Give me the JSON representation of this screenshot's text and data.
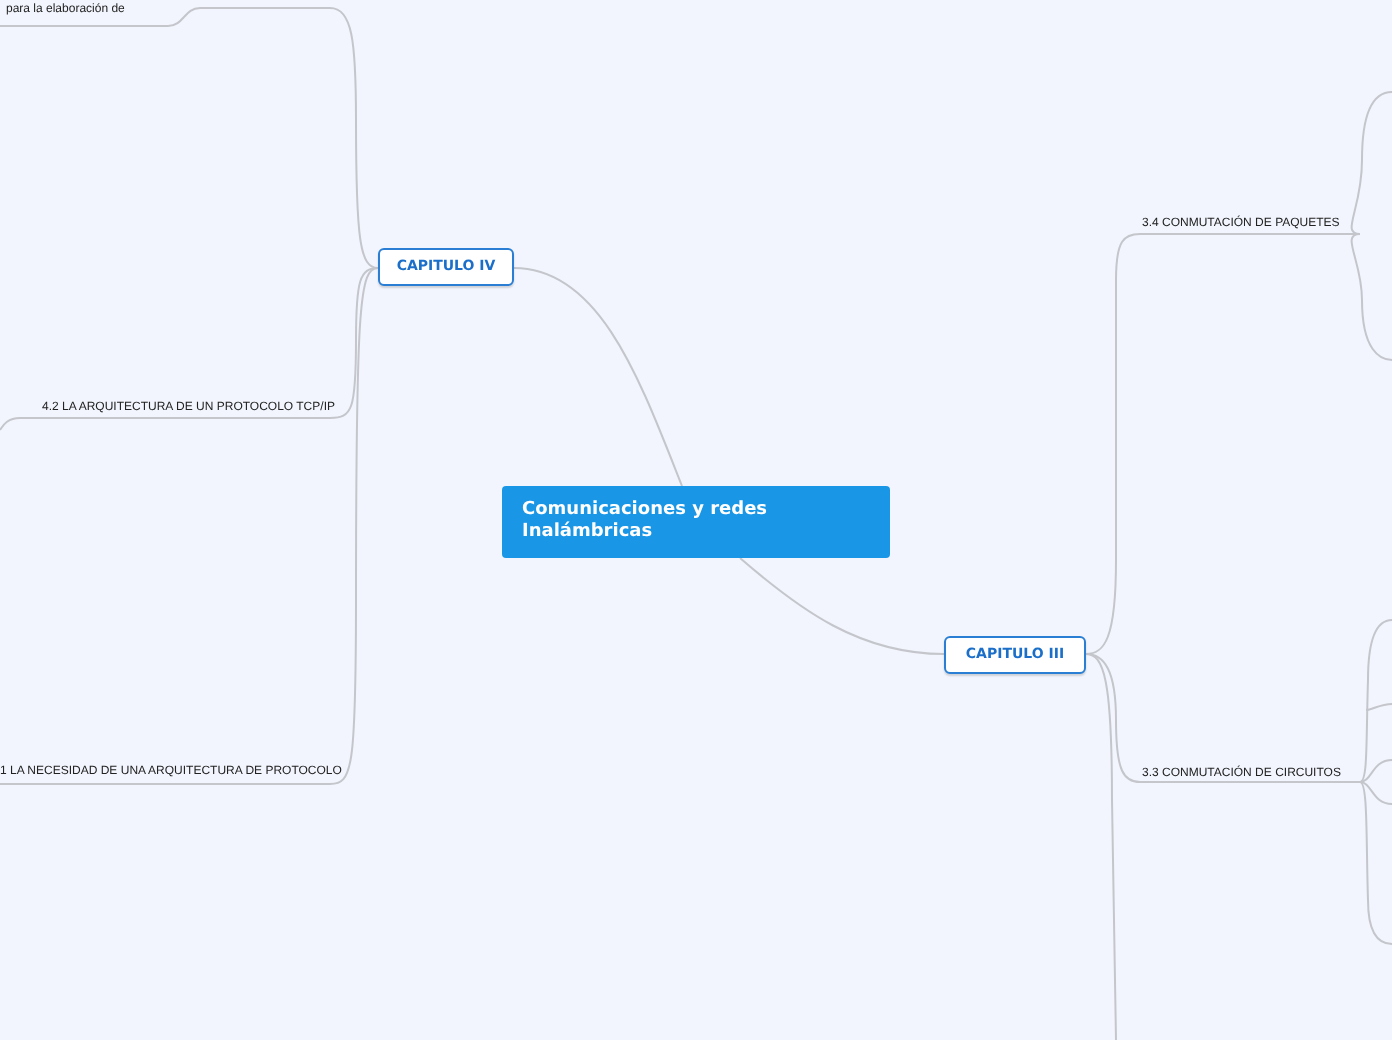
{
  "central_topic": "Comunicaciones y redes Inalámbricas",
  "branches": [
    {
      "label": "CAPITULO IV",
      "subtopics": [
        "para la elaboración de",
        "4.2 LA ARQUITECTURA DE UN PROTOCOLO TCP/IP",
        "1 LA NECESIDAD DE UNA ARQUITECTURA DE PROTOCOLO"
      ]
    },
    {
      "label": "CAPITULO III",
      "subtopics": [
        "3.4 CONMUTACIÓN DE PAQUETES",
        "3.3 CONMUTACIÓN DE CIRCUITOS"
      ]
    }
  ]
}
